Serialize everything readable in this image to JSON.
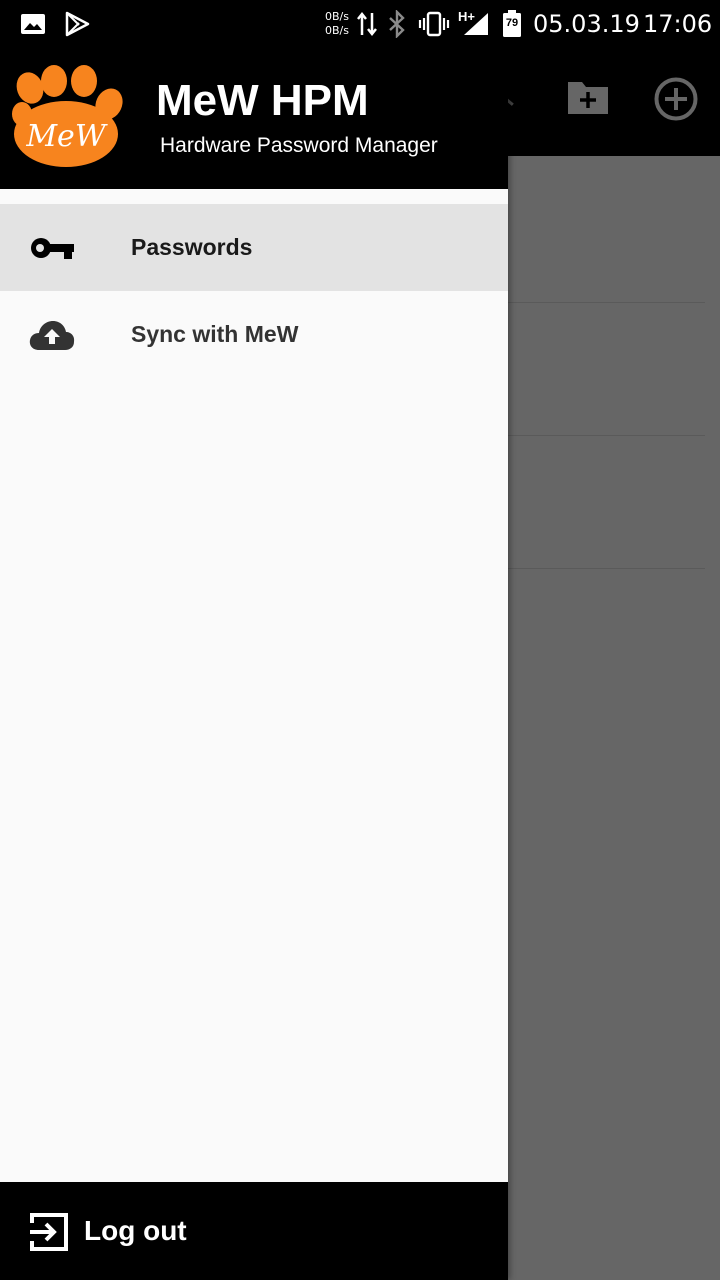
{
  "status_bar": {
    "net_up": "0B/s",
    "net_down": "0B/s",
    "network_type": "H+",
    "battery": "79",
    "date": "05.03.19",
    "time": "17:06",
    "icons": [
      "image-icon",
      "play-store-icon",
      "data-transfer-icon",
      "bluetooth-icon",
      "vibrate-icon",
      "signal-icon",
      "battery-icon"
    ]
  },
  "drawer": {
    "header": {
      "logo_text": "MeW",
      "title": "MeW HPM",
      "subtitle": "Hardware Password Manager",
      "logo_color": "#F7841E"
    },
    "items": [
      {
        "label": "Passwords",
        "icon": "key-icon",
        "active": true
      },
      {
        "label": "Sync with MeW",
        "icon": "cloud-upload-icon",
        "active": false
      }
    ],
    "footer": {
      "label": "Log out",
      "icon": "logout-icon"
    }
  },
  "app_bar": {
    "actions": [
      "new-folder-icon",
      "add-circle-icon"
    ]
  },
  "colors": {
    "scrim": "#666666",
    "active_item_bg": "#E3E3E3",
    "drawer_bg": "#FAFAFA"
  }
}
